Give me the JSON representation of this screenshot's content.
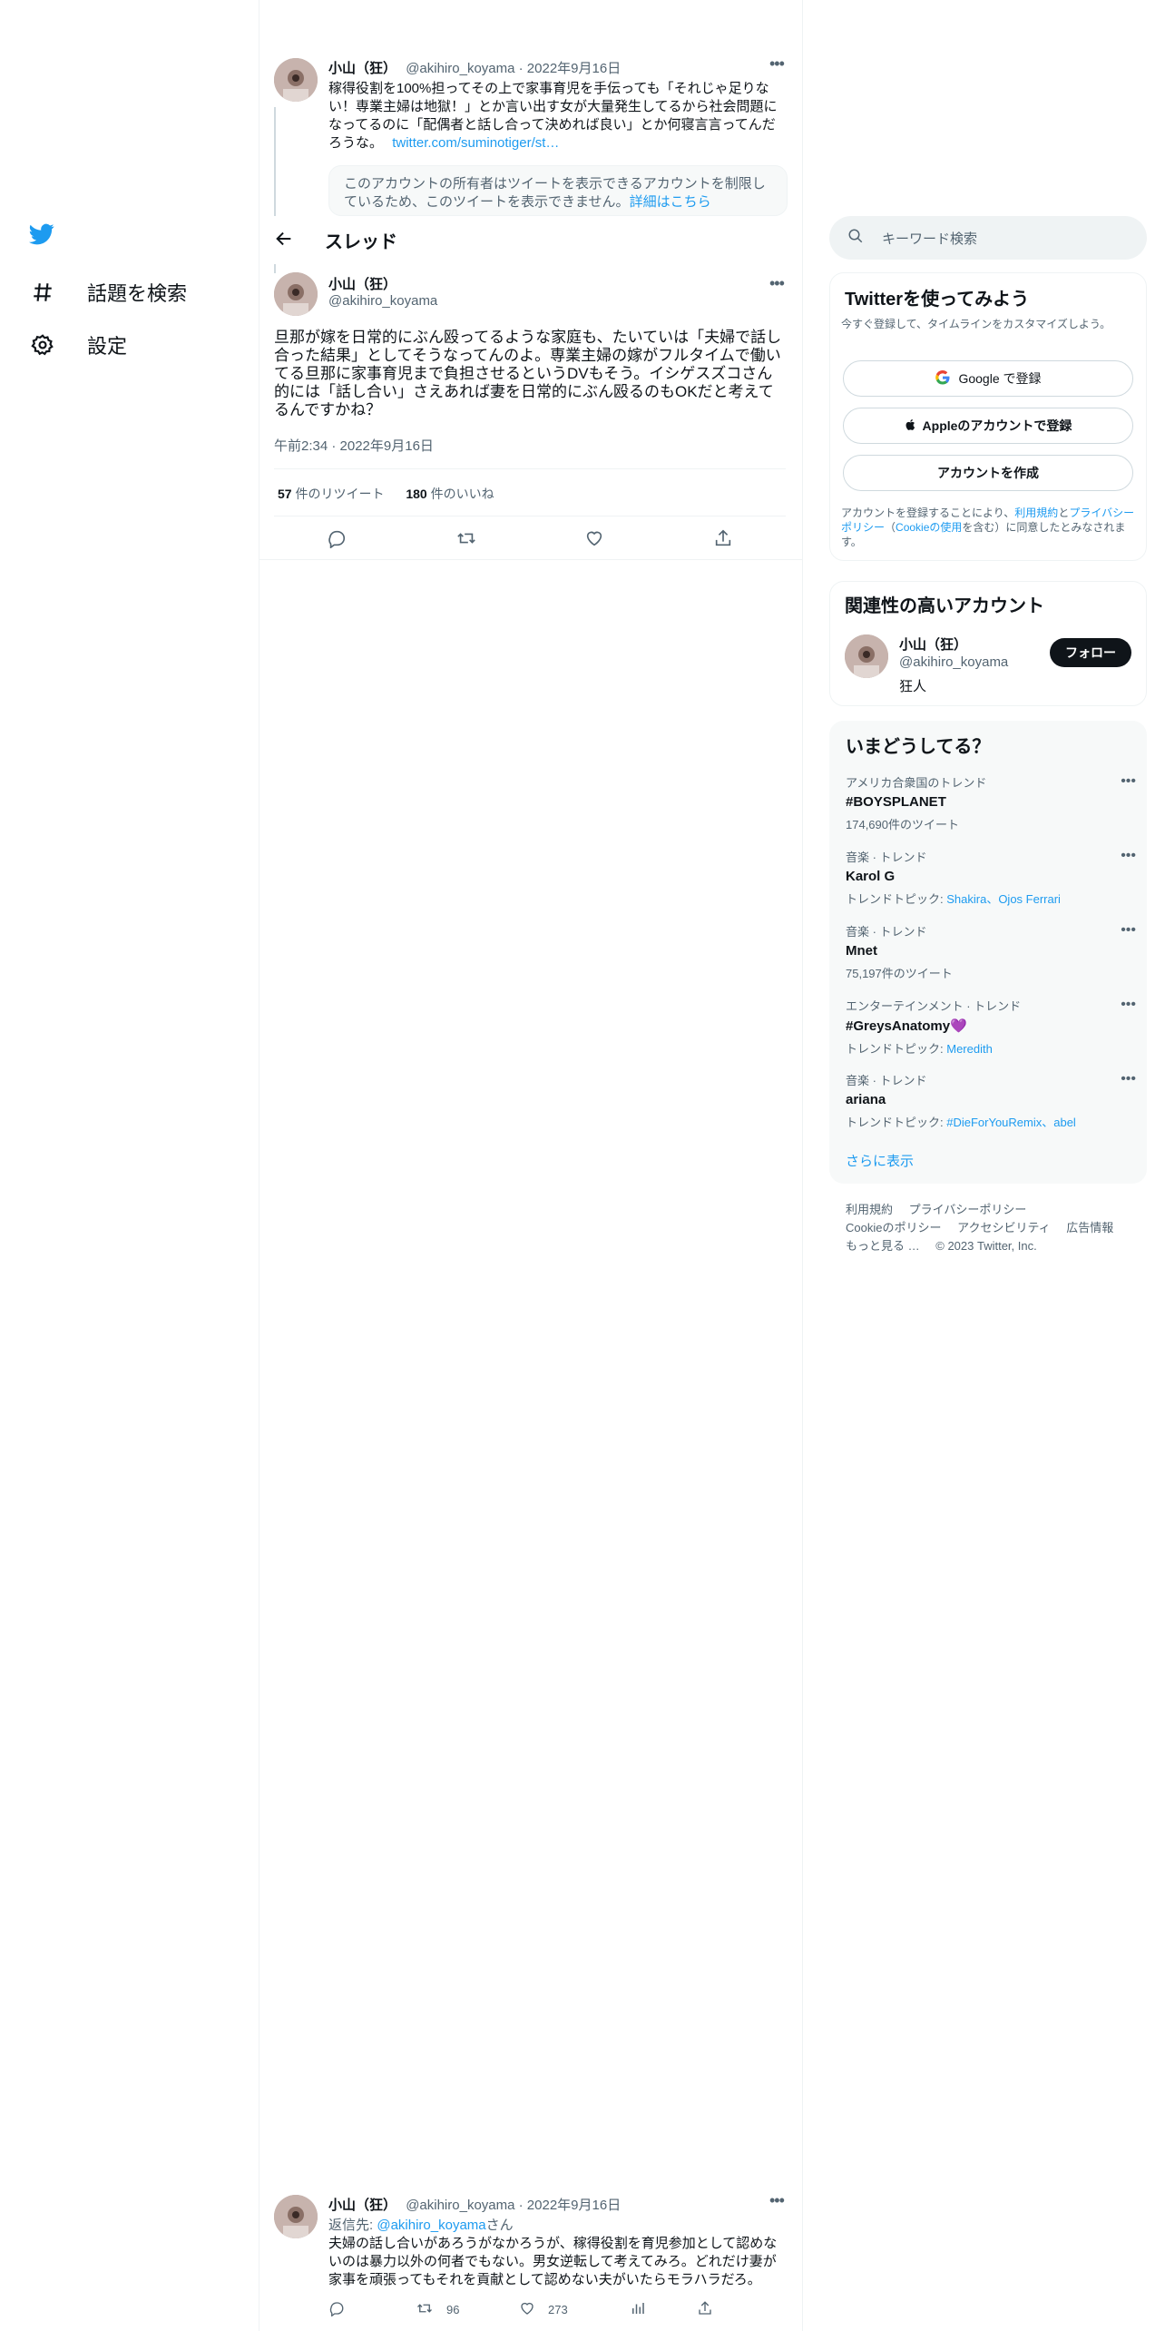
{
  "nav": {
    "explore_label": "話題を検索",
    "settings_label": "設定"
  },
  "header": {
    "title": "スレッド"
  },
  "parent_tweet": {
    "name": "小山（狂）",
    "handle": "@akihiro_koyama",
    "date": "· 2022年9月16日",
    "text": "稼得役割を100%担ってその上で家事育児を手伝っても「それじゃ足りない！専業主婦は地獄！」とか言い出す女が大量発生してるから社会問題になってるのに「配偶者と話し合って決めれば良い」とか何寝言言ってんだろうな。",
    "link": "twitter.com/suminotiger/st…",
    "quote_notice": "このアカウントの所有者はツイートを表示できるアカウントを制限しているため、このツイートを表示できません。",
    "quote_link": "詳細はこちら"
  },
  "main_tweet": {
    "name": "小山（狂）",
    "handle": "@akihiro_koyama",
    "text": "旦那が嫁を日常的にぶん殴ってるような家庭も、たいていは「夫婦で話し合った結果」としてそうなってんのよ。専業主婦の嫁がフルタイムで働いてる旦那に家事育児まで負担させるというDVもそう。イシゲスズコさん的には「話し合い」さえあれば妻を日常的にぶん殴るのもOKだと考えてるんですかね？",
    "timestamp": "午前2:34 · 2022年9月16日",
    "retweets_count": "57",
    "retweets_label": "件のリツイート",
    "likes_count": "180",
    "likes_label": "件のいいね"
  },
  "reply_tweet": {
    "name": "小山（狂）",
    "handle": "@akihiro_koyama",
    "date": "· 2022年9月16日",
    "reply_prefix": "返信先: ",
    "reply_to": "@akihiro_koyama",
    "reply_suffix": "さん",
    "text": "夫婦の話し合いがあろうがなかろうが、稼得役割を育児参加として認めないのは暴力以外の何者でもない。男女逆転して考えてみろ。どれだけ妻が家事を頑張ってもそれを貢献として認めない夫がいたらモラハラだろ。",
    "retweets": "96",
    "likes": "273"
  },
  "search": {
    "placeholder": "キーワード検索"
  },
  "signup": {
    "title": "Twitterを使ってみよう",
    "subtitle": "今すぐ登録して、タイムラインをカスタマイズしよう。",
    "google_label": "Google で登録",
    "apple_label": "Appleのアカウントで登録",
    "create_label": "アカウントを作成",
    "legal_1": "アカウントを登録することにより、",
    "legal_terms": "利用規約",
    "legal_2": "と",
    "legal_privacy": "プライバシーポリシー",
    "legal_3": "（",
    "legal_cookie": "Cookieの使用",
    "legal_4": "を含む）に同意したとみなされます。"
  },
  "related": {
    "title": "関連性の高いアカウント",
    "name": "小山（狂）",
    "handle": "@akihiro_koyama",
    "bio": "狂人",
    "follow_label": "フォロー"
  },
  "trends": {
    "title": "いまどうしてる？",
    "items": [
      {
        "meta": "アメリカ合衆国のトレンド",
        "name": "#BOYSPLANET",
        "sub": "174,690件のツイート",
        "sub_link": ""
      },
      {
        "meta": "音楽 · トレンド",
        "name": "Karol G",
        "sub": "トレンドトピック: ",
        "sub_link": "Shakira、Ojos Ferrari"
      },
      {
        "meta": "音楽 · トレンド",
        "name": "Mnet",
        "sub": "75,197件のツイート",
        "sub_link": ""
      },
      {
        "meta": "エンターテインメント · トレンド",
        "name": "#GreysAnatomy💜",
        "sub": "トレンドトピック: ",
        "sub_link": "Meredith"
      },
      {
        "meta": "音楽 · トレンド",
        "name": "ariana",
        "sub": "トレンドトピック: ",
        "sub_link": "#DieForYouRemix、abel"
      }
    ],
    "show_more": "さらに表示"
  },
  "footer": {
    "terms": "利用規約",
    "privacy": "プライバシーポリシー",
    "cookie": "Cookieのポリシー",
    "accessibility": "アクセシビリティ",
    "ads": "広告情報",
    "more": "もっと見る …",
    "copyright": "© 2023 Twitter, Inc."
  },
  "colors": {
    "accent": "#1d9bf0",
    "text": "#0f1419",
    "muted": "#536471",
    "border": "#eff3f4"
  }
}
